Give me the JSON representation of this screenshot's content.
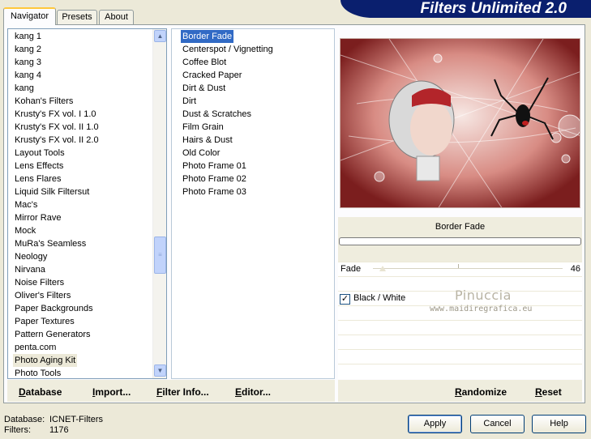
{
  "app": {
    "title": "Filters Unlimited 2.0"
  },
  "tabs": [
    {
      "label": "Navigator",
      "active": true
    },
    {
      "label": "Presets",
      "active": false
    },
    {
      "label": "About",
      "active": false
    }
  ],
  "categories": [
    "kang 1",
    "kang 2",
    "kang 3",
    "kang 4",
    "kang",
    "Kohan's Filters",
    "Krusty's FX vol. I 1.0",
    "Krusty's FX vol. II 1.0",
    "Krusty's FX vol. II 2.0",
    "Layout Tools",
    "Lens Effects",
    "Lens Flares",
    "Liquid Silk Filtersut",
    "Mac's",
    "Mirror Rave",
    "Mock",
    "MuRa's Seamless",
    "Neology",
    "Nirvana",
    "Noise Filters",
    "Oliver's Filters",
    "Paper Backgrounds",
    "Paper Textures",
    "Pattern Generators",
    "penta.com",
    "Photo Aging Kit",
    "Photo Tools"
  ],
  "selected_category": "Photo Aging Kit",
  "filters": [
    "Border Fade",
    "Centerspot / Vignetting",
    "Coffee Blot",
    "Cracked Paper",
    "Dirt & Dust",
    "Dirt",
    "Dust & Scratches",
    "Film Grain",
    "Hairs & Dust",
    "Old Color",
    "Photo Frame 01",
    "Photo Frame 02",
    "Photo Frame 03"
  ],
  "selected_filter": "Border Fade",
  "params": {
    "filter_title": "Border Fade",
    "fade_label": "Fade",
    "fade_value": "46",
    "checkbox_label": "Black / White",
    "checkbox_checked": true
  },
  "watermark": {
    "name": "Pinuccia",
    "site": "www.maidiregrafica.eu"
  },
  "toolbar": {
    "database": "Database",
    "import": "Import...",
    "filter_info": "Filter Info...",
    "editor": "Editor...",
    "randomize": "Randomize",
    "reset": "Reset"
  },
  "status": {
    "database_label": "Database:",
    "database_value": "ICNET-Filters",
    "filters_label": "Filters:",
    "filters_value": "1176"
  },
  "buttons": {
    "apply": "Apply",
    "cancel": "Cancel",
    "help": "Help"
  },
  "colors": {
    "banner": "#0a1f6e",
    "selection": "#316ac5",
    "face": "#ece9d8"
  }
}
